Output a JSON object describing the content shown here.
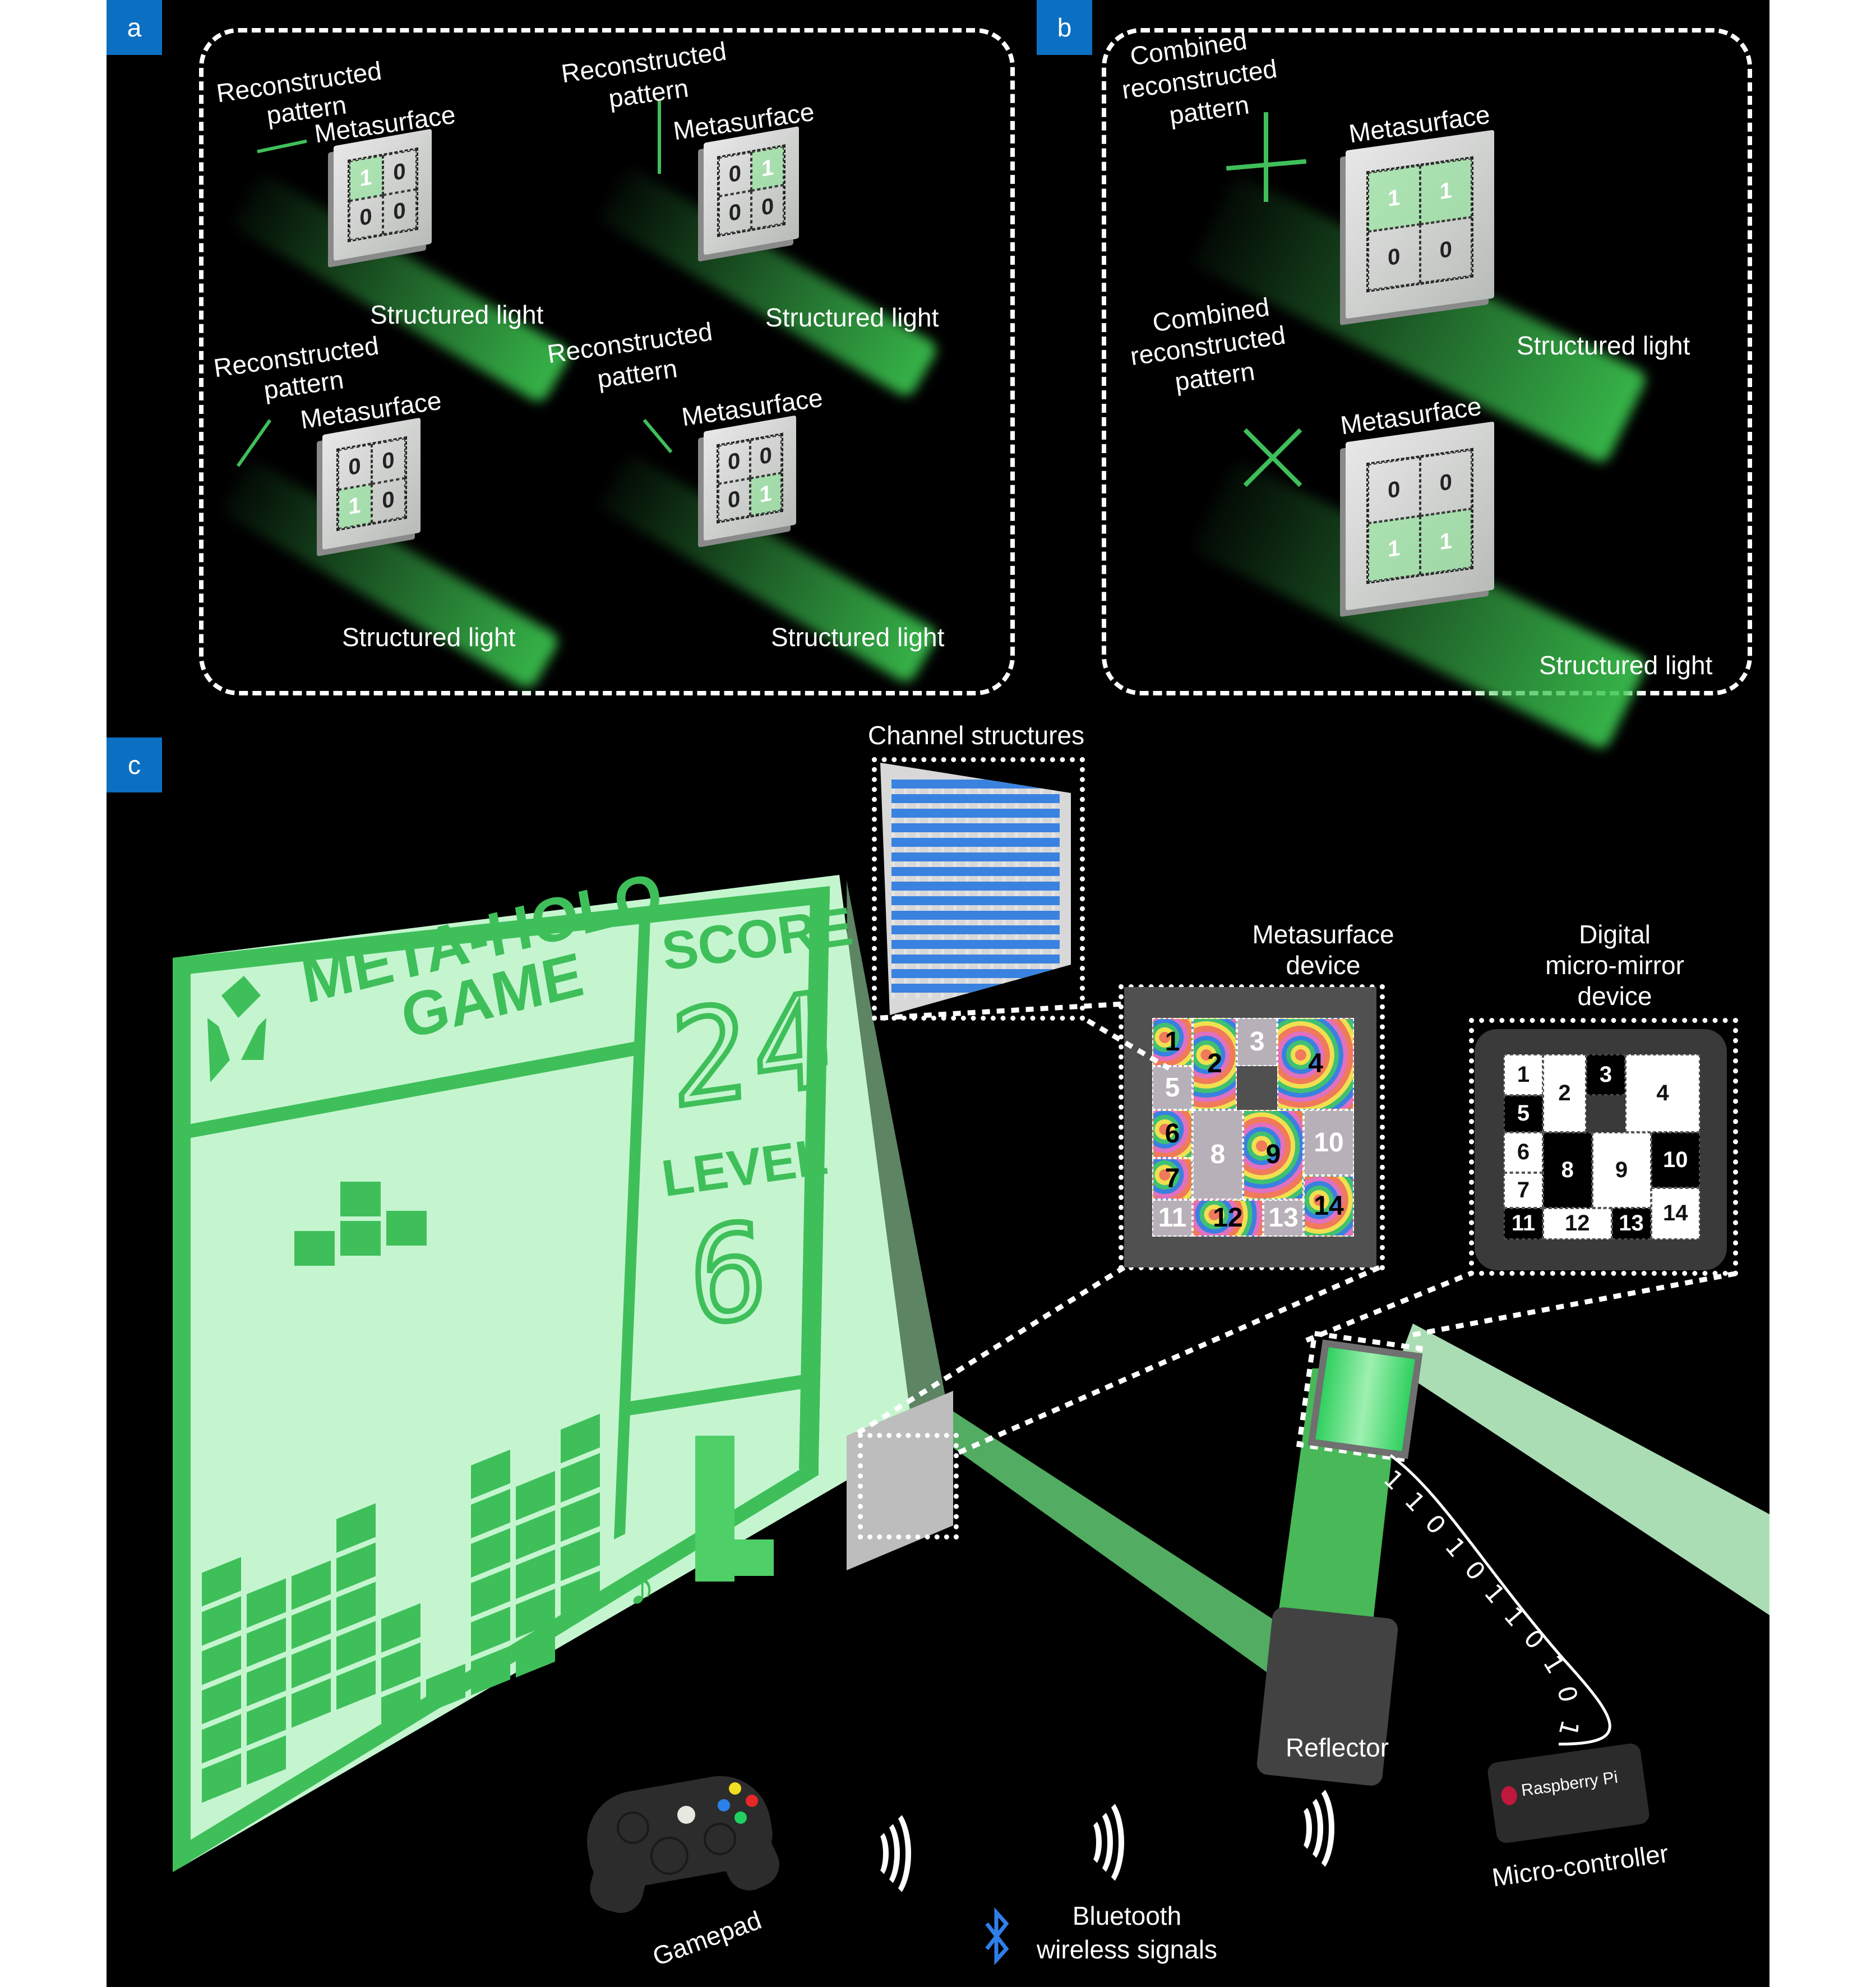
{
  "colors": {
    "panel_label_bg": "#0b70c2",
    "background": "#000000",
    "screen_bg": "#c5f5cf",
    "screen_green": "#3fbf5a",
    "bluetooth_blue": "#2f7fe8"
  },
  "panel_a": {
    "label": "a",
    "units": [
      {
        "reconstructed_label_1": "Reconstructed",
        "reconstructed_label_2": "pattern",
        "metasurface_label": "Metasurface",
        "structured_light_label": "Structured light",
        "bits": [
          "1",
          "0",
          "0",
          "0"
        ],
        "pattern": "horizontal-line"
      },
      {
        "reconstructed_label_1": "Reconstructed",
        "reconstructed_label_2": "pattern",
        "metasurface_label": "Metasurface",
        "structured_light_label": "Structured light",
        "bits": [
          "0",
          "1",
          "0",
          "0"
        ],
        "pattern": "vertical-line"
      },
      {
        "reconstructed_label_1": "Reconstructed",
        "reconstructed_label_2": "pattern",
        "metasurface_label": "Metasurface",
        "structured_light_label": "Structured light",
        "bits": [
          "0",
          "0",
          "1",
          "0"
        ],
        "pattern": "forward-diagonal-line"
      },
      {
        "reconstructed_label_1": "Reconstructed",
        "reconstructed_label_2": "pattern",
        "metasurface_label": "Metasurface",
        "structured_light_label": "Structured light",
        "bits": [
          "0",
          "0",
          "0",
          "1"
        ],
        "pattern": "backward-diagonal-line"
      }
    ]
  },
  "panel_b": {
    "label": "b",
    "units": [
      {
        "combined_label_1": "Combined",
        "combined_label_2": "reconstructed",
        "combined_label_3": "pattern",
        "metasurface_label": "Metasurface",
        "structured_light_label": "Structured light",
        "bits": [
          "1",
          "1",
          "0",
          "0"
        ],
        "pattern": "plus"
      },
      {
        "combined_label_1": "Combined",
        "combined_label_2": "reconstructed",
        "combined_label_3": "pattern",
        "metasurface_label": "Metasurface",
        "structured_light_label": "Structured light",
        "bits": [
          "0",
          "0",
          "1",
          "1"
        ],
        "pattern": "cross"
      }
    ]
  },
  "panel_c": {
    "label": "c",
    "game": {
      "title_line1": "META-HOLO",
      "title_line2": "GAME",
      "score_label": "SCORE",
      "score_value": "24",
      "level_label": "LEVEL",
      "level_value": "6",
      "next_piece": "L",
      "music_icon": "♪",
      "stack_column_heights": [
        6,
        5,
        4,
        5,
        3,
        1,
        6,
        5,
        5
      ],
      "stack_column_bottom_offsets": [
        0,
        0,
        1,
        1,
        0,
        0,
        0,
        0,
        1
      ],
      "falling_piece": "T"
    },
    "channel_structures_label": "Channel structures",
    "metasurface_device": {
      "label_1": "Metasurface",
      "label_2": "device",
      "channels": [
        {
          "id": "1",
          "active": true
        },
        {
          "id": "2",
          "active": true
        },
        {
          "id": "3",
          "active": false
        },
        {
          "id": "4",
          "active": true
        },
        {
          "id": "5",
          "active": false
        },
        {
          "id": "6",
          "active": true
        },
        {
          "id": "7",
          "active": true
        },
        {
          "id": "8",
          "active": false
        },
        {
          "id": "9",
          "active": true
        },
        {
          "id": "10",
          "active": false
        },
        {
          "id": "11",
          "active": false
        },
        {
          "id": "12",
          "active": true
        },
        {
          "id": "13",
          "active": false
        },
        {
          "id": "14",
          "active": true
        }
      ]
    },
    "dmd": {
      "label_1": "Digital",
      "label_2": "micro-mirror",
      "label_3": "device",
      "mirrors": [
        {
          "id": "1",
          "on": true
        },
        {
          "id": "2",
          "on": true
        },
        {
          "id": "3",
          "on": false
        },
        {
          "id": "4",
          "on": true
        },
        {
          "id": "5",
          "on": false
        },
        {
          "id": "6",
          "on": true
        },
        {
          "id": "7",
          "on": true
        },
        {
          "id": "8",
          "on": false
        },
        {
          "id": "9",
          "on": true
        },
        {
          "id": "10",
          "on": false
        },
        {
          "id": "11",
          "on": false
        },
        {
          "id": "12",
          "on": true
        },
        {
          "id": "13",
          "on": false
        },
        {
          "id": "14",
          "on": true
        }
      ]
    },
    "binary_signal": "1101011010100101",
    "reflector_label": "Reflector",
    "microcontroller_label": "Micro-controller",
    "microcontroller_brand": "Raspberry Pi",
    "gamepad_label": "Gamepad",
    "bluetooth_label_1": "Bluetooth",
    "bluetooth_label_2": "wireless signals"
  }
}
